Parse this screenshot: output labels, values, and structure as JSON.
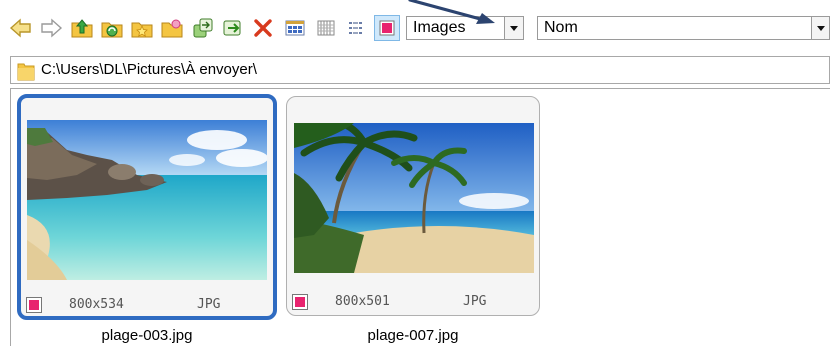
{
  "toolbar": {
    "buttons": [
      {
        "name": "back-arrow-icon"
      },
      {
        "name": "forward-arrow-icon"
      },
      {
        "name": "folder-up-icon"
      },
      {
        "name": "folder-refresh-icon"
      },
      {
        "name": "folder-favorite-icon"
      },
      {
        "name": "folder-new-icon"
      },
      {
        "name": "copy-to-icon"
      },
      {
        "name": "move-to-icon"
      },
      {
        "name": "delete-icon"
      },
      {
        "name": "thumbnails-view-icon"
      },
      {
        "name": "details-view-icon"
      },
      {
        "name": "list-view-icon"
      },
      {
        "name": "color-label-icon",
        "pressed": true,
        "color": "#e8236e"
      }
    ],
    "filter_value": "Images",
    "sort_value": "Nom"
  },
  "path": {
    "text": "C:\\Users\\DL\\Pictures\\À envoyer\\"
  },
  "thumbnails": [
    {
      "filename": "plage-003.jpg",
      "dimensions": "800x534",
      "type": "JPG",
      "selected": true,
      "label_color": "#e8236e"
    },
    {
      "filename": "plage-007.jpg",
      "dimensions": "800x501",
      "type": "JPG",
      "selected": false,
      "label_color": "#e8236e"
    }
  ],
  "colors": {
    "selection_border": "#2f6bc1",
    "pressed_button_bg": "#cfe8fb",
    "annotation_arrow": "#2c4470"
  }
}
